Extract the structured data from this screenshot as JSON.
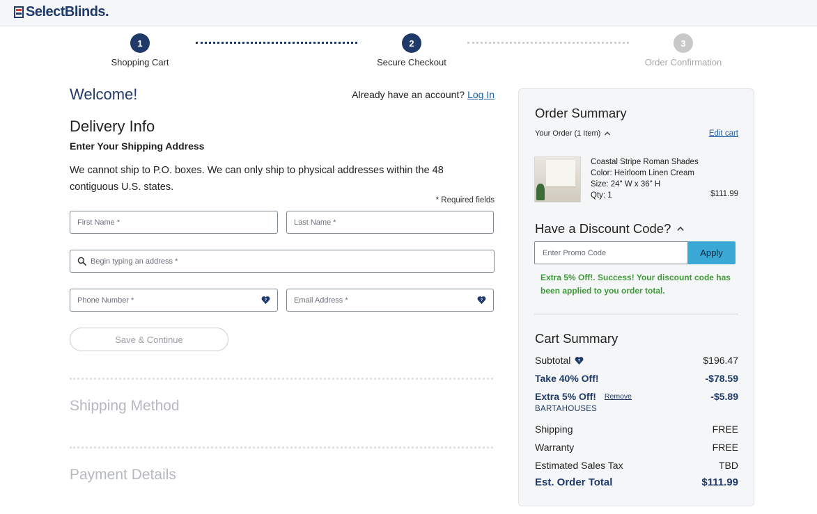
{
  "header": {
    "logo_text": "SelectBlinds."
  },
  "steps": [
    {
      "number": "1",
      "label": "Shopping Cart",
      "state": "active"
    },
    {
      "number": "2",
      "label": "Secure Checkout",
      "state": "active"
    },
    {
      "number": "3",
      "label": "Order Confirmation",
      "state": "inactive"
    }
  ],
  "form": {
    "welcome": "Welcome!",
    "account_prompt": "Already have an account?",
    "login_link": "Log In",
    "section_title": "Delivery Info",
    "section_subtitle": "Enter Your Shipping Address",
    "notice": "We cannot ship to P.O. boxes. We can only ship to physical addresses within the 48 contiguous U.S. states.",
    "required_note": "* Required fields",
    "first_name_placeholder": "First Name *",
    "last_name_placeholder": "Last Name *",
    "address_placeholder": "Begin typing an address *",
    "phone_placeholder": "Phone Number *",
    "email_placeholder": "Email Address *",
    "save_label": "Save & Continue",
    "shipping_method_title": "Shipping Method",
    "payment_details_title": "Payment Details"
  },
  "summary": {
    "title": "Order Summary",
    "your_order": "Your Order (1 Item)",
    "edit_cart": "Edit cart",
    "product": {
      "name": "Coastal Stripe Roman Shades",
      "color": "Color: Heirloom Linen Cream",
      "size": "Size: 24\" W x 36\" H",
      "qty": "Qty: 1",
      "price": "$111.99"
    },
    "discount_title": "Have a Discount Code?",
    "promo_placeholder": "Enter Promo Code",
    "apply_label": "Apply",
    "success_message": "Extra 5% Off!. Success! Your discount code has been applied to you order total.",
    "cart_title": "Cart Summary",
    "subtotal_label": "Subtotal",
    "subtotal_value": "$196.47",
    "discount1_label": "Take 40% Off!",
    "discount1_value": "-$78.59",
    "discount2_label": "Extra 5% Off!",
    "remove_label": "Remove",
    "discount2_value": "-$5.89",
    "promo_code": "BARTAHOUSES",
    "shipping_label": "Shipping",
    "shipping_value": "FREE",
    "warranty_label": "Warranty",
    "warranty_value": "FREE",
    "tax_label": "Estimated Sales Tax",
    "tax_value": "TBD",
    "total_label": "Est. Order Total",
    "total_value": "$111.99"
  },
  "colors": {
    "brand_navy": "#1f3a68",
    "apply_blue": "#3aa9d6",
    "success_green": "#3f9a3a",
    "link_blue": "#1f5fa8"
  },
  "icons": {
    "search": "search-icon",
    "info_heart": "heart-info-icon",
    "chevron_up": "chevron-up-icon"
  }
}
